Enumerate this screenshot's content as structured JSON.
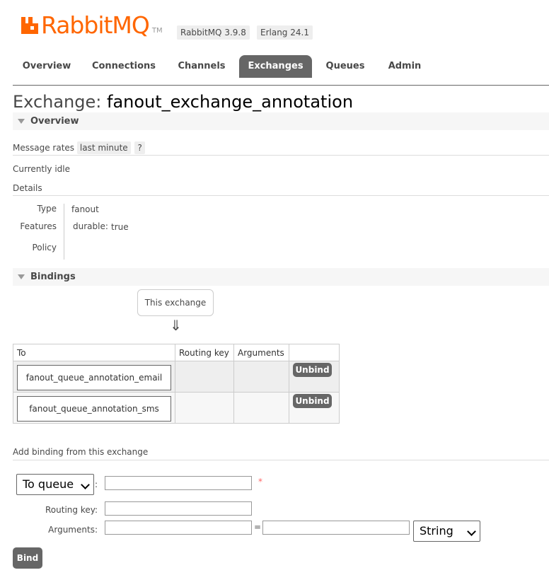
{
  "app": {
    "logo_text": "RabbitMQ",
    "logo_tm": "TM",
    "version_badge": "RabbitMQ 3.9.8",
    "erlang_badge": "Erlang 24.1",
    "brand_color": "#ff6600"
  },
  "nav": {
    "tabs": [
      {
        "label": "Overview",
        "active": false
      },
      {
        "label": "Connections",
        "active": false
      },
      {
        "label": "Channels",
        "active": false
      },
      {
        "label": "Exchanges",
        "active": true
      },
      {
        "label": "Queues",
        "active": false
      },
      {
        "label": "Admin",
        "active": false
      }
    ]
  },
  "page": {
    "title_prefix": "Exchange:",
    "exchange_name": "fanout_exchange_annotation"
  },
  "overview": {
    "header": "Overview",
    "message_rates_label": "Message rates",
    "rate_period": "last minute",
    "help": "?",
    "status": "Currently idle",
    "details_label": "Details",
    "type_label": "Type",
    "type_value": "fanout",
    "features_label": "Features",
    "feature_key": "durable:",
    "feature_value": "true",
    "policy_label": "Policy"
  },
  "bindings": {
    "header": "Bindings",
    "source_box": "This exchange",
    "arrow": "⇓",
    "columns": [
      "To",
      "Routing key",
      "Arguments"
    ],
    "rows": [
      {
        "to": "fanout_queue_annotation_email",
        "routing_key": "",
        "arguments": "",
        "action": "Unbind"
      },
      {
        "to": "fanout_queue_annotation_sms",
        "routing_key": "",
        "arguments": "",
        "action": "Unbind"
      }
    ]
  },
  "add_binding": {
    "title": "Add binding from this exchange",
    "destination_type": "To queue",
    "colon": ":",
    "destination_value": "",
    "required_mark": "*",
    "routing_key_label": "Routing key:",
    "routing_key_value": "",
    "arguments_label": "Arguments:",
    "arg_key": "",
    "equals": "=",
    "arg_value": "",
    "arg_type": "String",
    "submit": "Bind"
  }
}
